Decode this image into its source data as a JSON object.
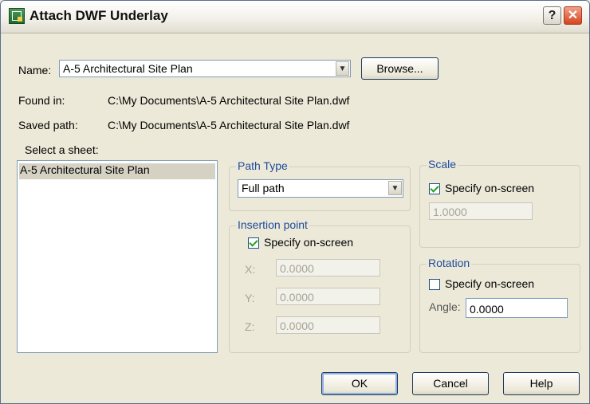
{
  "window": {
    "title": "Attach DWF Underlay"
  },
  "titlebar": {
    "help_label": "?",
    "close_label": "✕"
  },
  "name_row": {
    "label": "Name:",
    "value": "A-5 Architectural Site Plan",
    "browse_label": "Browse..."
  },
  "info": {
    "found_in_label": "Found in:",
    "found_in_value": "C:\\My Documents\\A-5 Architectural Site Plan.dwf",
    "saved_path_label": "Saved path:",
    "saved_path_value": "C:\\My Documents\\A-5 Architectural Site Plan.dwf"
  },
  "sheet": {
    "label": "Select a sheet:",
    "items": [
      "A-5 Architectural Site Plan"
    ],
    "selected": "A-5 Architectural Site Plan"
  },
  "path_type": {
    "title": "Path Type",
    "value": "Full path"
  },
  "insertion_point": {
    "title": "Insertion point",
    "specify_label": "Specify on-screen",
    "specify_checked": true,
    "x_label": "X:",
    "x_value": "0.0000",
    "y_label": "Y:",
    "y_value": "0.0000",
    "z_label": "Z:",
    "z_value": "0.0000"
  },
  "scale": {
    "title": "Scale",
    "specify_label": "Specify on-screen",
    "specify_checked": true,
    "value": "1.0000"
  },
  "rotation": {
    "title": "Rotation",
    "specify_label": "Specify on-screen",
    "specify_checked": false,
    "angle_label": "Angle:",
    "angle_value": "0.0000"
  },
  "buttons": {
    "ok": "OK",
    "cancel": "Cancel",
    "help": "Help"
  },
  "colors": {
    "group_title": "#1f4a9b",
    "dialog_bg": "#ece9d8",
    "selection_bg": "#d5d2c4"
  },
  "icons": {
    "app": "autocad-underlay-icon",
    "dropdown": "chevron-down-icon",
    "check": "checkmark-icon"
  }
}
